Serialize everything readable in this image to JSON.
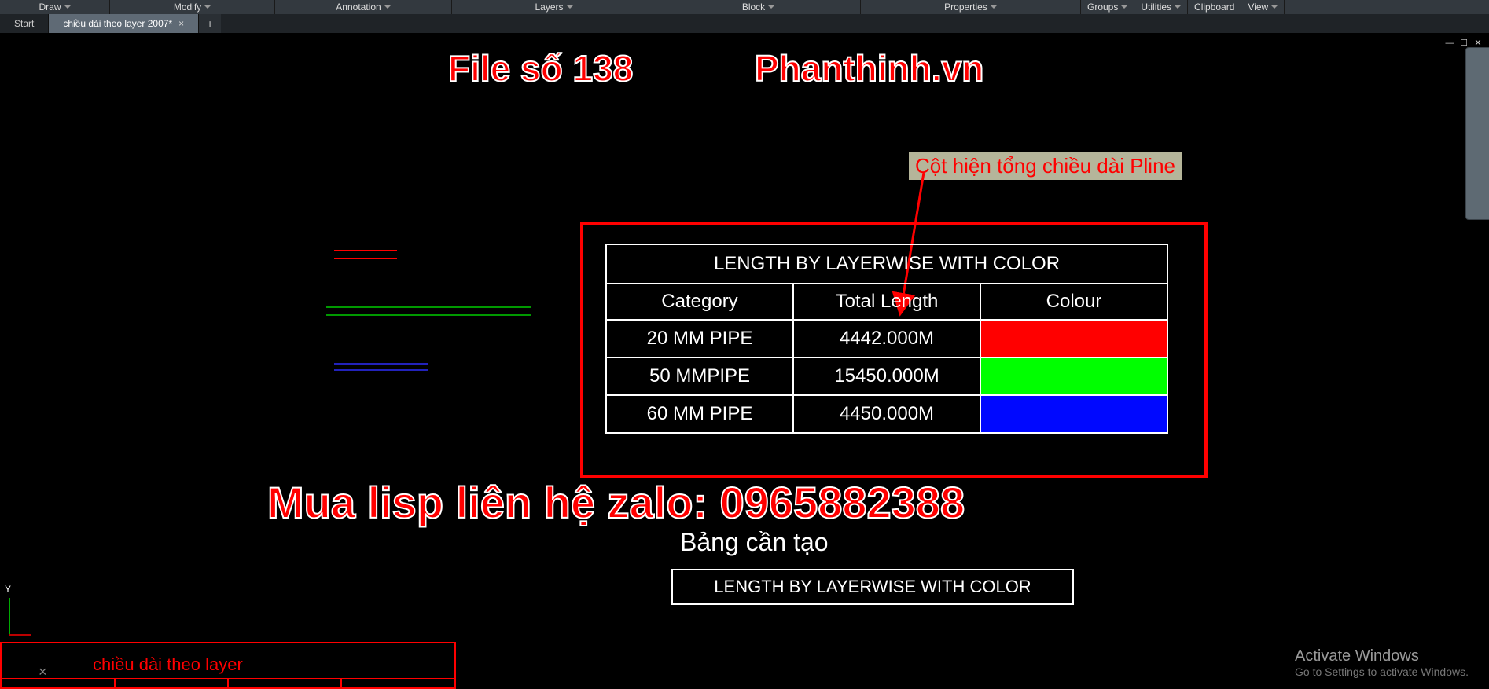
{
  "ribbon": {
    "panels": [
      "Draw",
      "Modify",
      "Annotation",
      "Layers",
      "Block",
      "Properties",
      "Groups",
      "Utilities",
      "Clipboard",
      "View"
    ]
  },
  "tabs": {
    "start": "Start",
    "active": "chiều dài theo layer 2007*"
  },
  "overlay": {
    "title_left": "File số 138",
    "title_right": "Phanthinh.vn",
    "promo": "Mua lisp liên hệ zalo: 0965882388"
  },
  "callout": "Cột hiện tổng chiều dài Pline",
  "table": {
    "title": "LENGTH BY LAYERWISE WITH COLOR",
    "headers": [
      "Category",
      "Total Length",
      "Colour"
    ],
    "rows": [
      {
        "category": "20 MM PIPE",
        "length": "4442.000M",
        "color_name": "red",
        "color": "#ff0000"
      },
      {
        "category": "50 MMPIPE",
        "length": "15450.000M",
        "color_name": "green",
        "color": "#00ff00"
      },
      {
        "category": "60 MM PIPE",
        "length": "4450.000M",
        "color_name": "blue",
        "color": "#0008ff"
      }
    ]
  },
  "bang_label": "Bảng cần tạo",
  "layers_box": {
    "label": "chiều dài theo layer"
  },
  "activate": {
    "line1": "Activate Windows",
    "line2": "Go to Settings to activate Windows."
  },
  "chart_data": {
    "type": "table",
    "title": "LENGTH BY LAYERWISE WITH COLOR",
    "columns": [
      "Category",
      "Total Length",
      "Colour"
    ],
    "rows": [
      [
        "20 MM PIPE",
        "4442.000M",
        "red"
      ],
      [
        "50 MMPIPE",
        "15450.000M",
        "green"
      ],
      [
        "60 MM PIPE",
        "4450.000M",
        "blue"
      ]
    ]
  }
}
